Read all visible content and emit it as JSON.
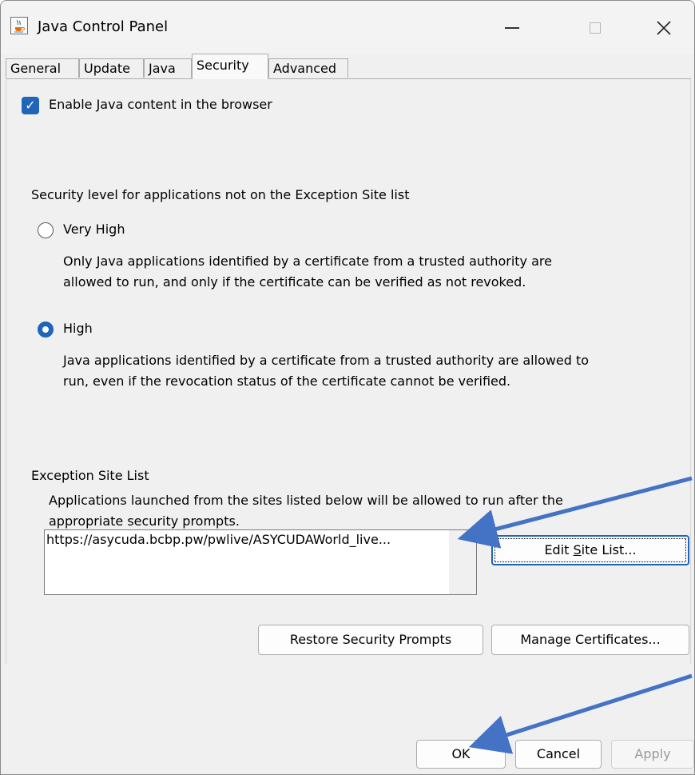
{
  "window": {
    "title": "Java Control Panel",
    "icon": "java-cup-icon",
    "controls": {
      "minimize": "—",
      "maximize": "☐",
      "close": "✕"
    }
  },
  "tabs": [
    {
      "label": "General",
      "active": false
    },
    {
      "label": "Update",
      "active": false
    },
    {
      "label": "Java",
      "active": false
    },
    {
      "label": "Security",
      "active": true
    },
    {
      "label": "Advanced",
      "active": false
    }
  ],
  "security": {
    "enable_checkbox": {
      "label": "Enable Java content in the browser",
      "checked": true
    },
    "level_heading": "Security level for applications not on the Exception Site list",
    "levels": [
      {
        "label": "Very High",
        "selected": false,
        "description": "Only Java applications identified by a certificate from a trusted authority are allowed to run, and only if the certificate can be verified as not revoked.",
        "lines": [
          "Only Java applications identified by a certificate from a trusted authority are",
          "allowed to run, and only if the certificate can be verified as not revoked."
        ]
      },
      {
        "label": "High",
        "selected": true,
        "description": "Java applications identified by a certificate from a trusted authority are allowed to run, even if the revocation status of the certificate cannot be verified.",
        "lines": [
          "Java applications identified by a certificate from a trusted authority are allowed to",
          "run, even if the revocation status of the certificate cannot be verified."
        ]
      }
    ],
    "exception": {
      "heading": "Exception Site List",
      "description": "Applications launched from the sites listed below will be allowed to run after the appropriate security prompts.",
      "lines": [
        "Applications launched from the sites listed below will be allowed to run after the",
        "appropriate security prompts."
      ],
      "sites": [
        "https://asycuda.bcbp.pw/pwlive/ASYCUDAWorld_live..."
      ],
      "edit_button": "Edit Site List...",
      "edit_button_mnemonic": "S"
    },
    "restore_button": "Restore Security Prompts",
    "manage_button": "Manage Certificates..."
  },
  "footer": {
    "ok": "OK",
    "cancel": "Cancel",
    "apply": "Apply",
    "apply_enabled": false
  },
  "colors": {
    "accent": "#1f65b9",
    "annotation_arrow": "#4472c4"
  }
}
